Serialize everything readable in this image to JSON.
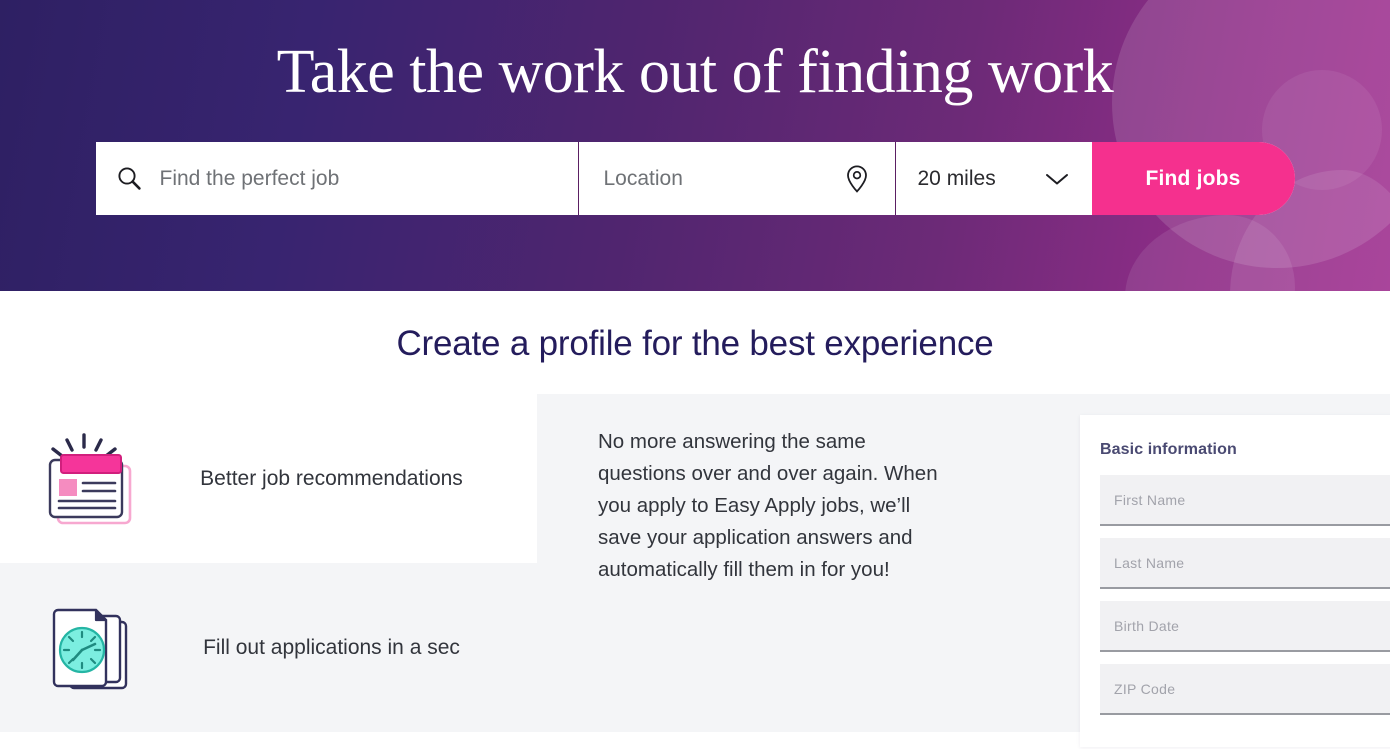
{
  "hero": {
    "title": "Take the work out of finding work",
    "gradient_from": "#2e2063",
    "gradient_to": "#a03090",
    "search": {
      "keyword_placeholder": "Find the perfect job",
      "keyword_value": "",
      "location_placeholder": "Location",
      "location_value": "",
      "radius_selected": "20 miles",
      "submit_label": "Find jobs",
      "submit_color": "#f5308e",
      "search_icon": "search-icon",
      "location_icon": "map-pin-icon",
      "dropdown_icon": "chevron-down-icon"
    }
  },
  "profile_section": {
    "heading": "Create a profile for the best experience",
    "heading_color": "#241c5c",
    "features": [
      {
        "label": "Better job recommendations",
        "icon": "resume-card-icon"
      },
      {
        "label": "Fill out applications in a sec",
        "icon": "documents-clock-icon"
      }
    ],
    "copy": "No more answering the same questions over and over again. When you apply to Easy Apply jobs, we’ll save your application answers and automatically fill them in for you!",
    "form_card": {
      "title": "Basic information",
      "fields": [
        {
          "placeholder": "First Name",
          "value": ""
        },
        {
          "placeholder": "Last Name",
          "value": ""
        },
        {
          "placeholder": "Birth Date",
          "value": ""
        },
        {
          "placeholder": "ZIP Code",
          "value": ""
        }
      ]
    }
  }
}
